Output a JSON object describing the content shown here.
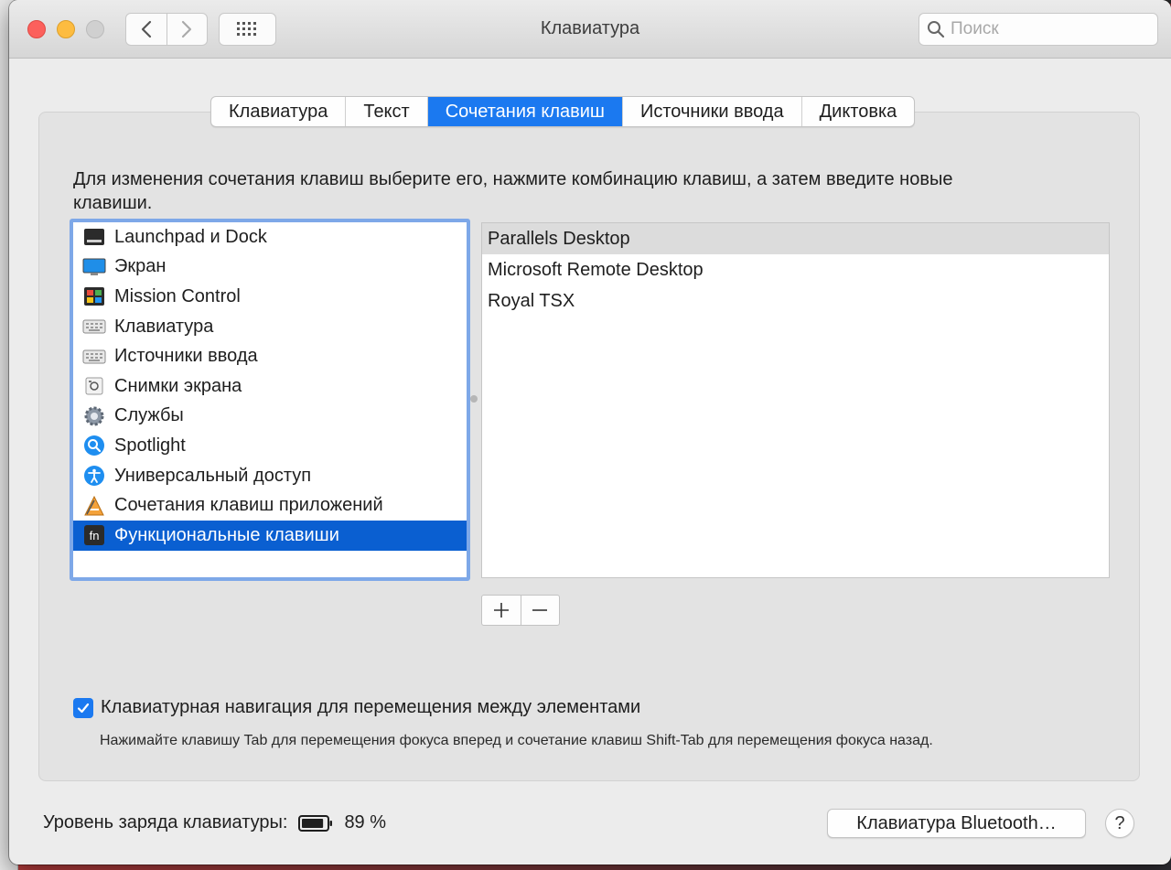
{
  "window": {
    "title": "Клавиатура"
  },
  "search": {
    "placeholder": "Поиск"
  },
  "tabs": [
    {
      "label": "Клавиатура"
    },
    {
      "label": "Текст"
    },
    {
      "label": "Сочетания клавиш",
      "active": true
    },
    {
      "label": "Источники ввода"
    },
    {
      "label": "Диктовка"
    }
  ],
  "instruction": "Для изменения сочетания клавиш выберите его, нажмите комбинацию клавиш, а затем введите новые клавиши.",
  "categories": [
    {
      "label": "Launchpad и Dock",
      "icon": "launchpad-dock-icon"
    },
    {
      "label": "Экран",
      "icon": "display-icon"
    },
    {
      "label": "Mission Control",
      "icon": "mission-control-icon"
    },
    {
      "label": "Клавиатура",
      "icon": "keyboard-icon"
    },
    {
      "label": "Источники ввода",
      "icon": "input-sources-icon"
    },
    {
      "label": "Снимки экрана",
      "icon": "screenshot-icon"
    },
    {
      "label": "Службы",
      "icon": "services-gear-icon"
    },
    {
      "label": "Spotlight",
      "icon": "spotlight-icon"
    },
    {
      "label": "Универсальный доступ",
      "icon": "accessibility-icon"
    },
    {
      "label": "Сочетания клавиш приложений",
      "icon": "app-shortcuts-icon"
    },
    {
      "label": "Функциональные клавиши",
      "icon": "fn-key-icon",
      "selected": true
    }
  ],
  "apps": [
    {
      "label": "Parallels Desktop",
      "highlighted": true
    },
    {
      "label": "Microsoft Remote Desktop"
    },
    {
      "label": "Royal TSX"
    }
  ],
  "keyboard_navigation": {
    "label": "Клавиатурная навигация для перемещения между элементами",
    "checked": true,
    "hint": "Нажимайте клавишу Tab для перемещения фокуса вперед и сочетание клавиш Shift-Tab для перемещения фокуса назад."
  },
  "battery": {
    "label": "Уровень заряда клавиатуры:",
    "value": "89 %",
    "level": 0.89
  },
  "bluetooth_button": "Клавиатура Bluetooth…",
  "help_button": "?",
  "colors": {
    "accent": "#1b79f0",
    "selection": "#0a5fd1",
    "focus_ring": "#7ea8e8"
  }
}
